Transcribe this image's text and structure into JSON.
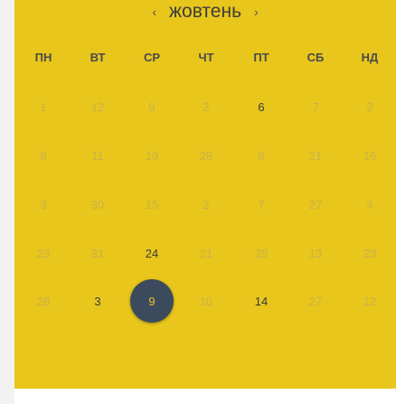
{
  "calendar": {
    "prev_icon": "chevron-left",
    "next_icon": "chevron-right",
    "month": "жовтень",
    "weekdays": [
      "ПН",
      "ВТ",
      "СР",
      "ЧТ",
      "ПТ",
      "СБ",
      "НД"
    ],
    "rows": [
      [
        {
          "d": "1",
          "active": false
        },
        {
          "d": "12",
          "active": false
        },
        {
          "d": "9",
          "active": false
        },
        {
          "d": "2",
          "active": false
        },
        {
          "d": "6",
          "active": true
        },
        {
          "d": "7",
          "active": false
        },
        {
          "d": "2",
          "active": false
        }
      ],
      [
        {
          "d": "8",
          "active": false
        },
        {
          "d": "11",
          "active": false
        },
        {
          "d": "19",
          "active": false
        },
        {
          "d": "28",
          "active": false
        },
        {
          "d": "8",
          "active": false
        },
        {
          "d": "21",
          "active": false
        },
        {
          "d": "16",
          "active": false
        }
      ],
      [
        {
          "d": "3",
          "active": false
        },
        {
          "d": "30",
          "active": false
        },
        {
          "d": "15",
          "active": false
        },
        {
          "d": "2",
          "active": false
        },
        {
          "d": "7",
          "active": false
        },
        {
          "d": "27",
          "active": false
        },
        {
          "d": "4",
          "active": false
        }
      ],
      [
        {
          "d": "23",
          "active": false
        },
        {
          "d": "31",
          "active": false
        },
        {
          "d": "24",
          "active": true
        },
        {
          "d": "21",
          "active": false
        },
        {
          "d": "25",
          "active": false
        },
        {
          "d": "13",
          "active": false
        },
        {
          "d": "23",
          "active": false
        }
      ],
      [
        {
          "d": "28",
          "active": false
        },
        {
          "d": "3",
          "active": true
        },
        {
          "d": "9",
          "active": true,
          "selected": true
        },
        {
          "d": "10",
          "active": false
        },
        {
          "d": "14",
          "active": true
        },
        {
          "d": "27",
          "active": false
        },
        {
          "d": "12",
          "active": false
        }
      ]
    ],
    "colors": {
      "background": "#e8c61c",
      "selected_circle": "#3c4a5e",
      "inactive_text": "#c9b14a",
      "active_text": "#3b3b3b"
    }
  }
}
